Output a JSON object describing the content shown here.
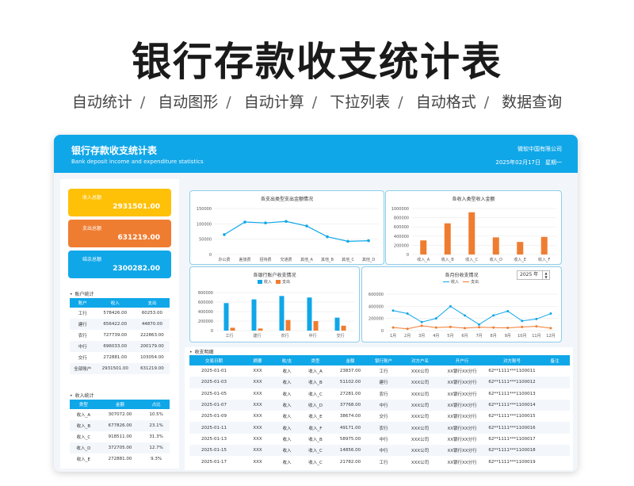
{
  "promo": {
    "title": "银行存款收支统计表",
    "features": [
      "自动统计",
      "自动图形",
      "自动计算",
      "下拉列表",
      "自动格式",
      "数据查询"
    ]
  },
  "header": {
    "title": "银行存款收支统计表",
    "subtitle": "Bank deposit income and expenditure statistics",
    "company": "微软中国有限公司",
    "date": "2025年02月17日",
    "weekday": "星期一"
  },
  "colors": {
    "blue": "#10a7e8",
    "yellow": "#ffc107",
    "orange": "#ef7d31",
    "cyan": "#10a7e8"
  },
  "cards": [
    {
      "label": "收入总额",
      "value": "2931501.00",
      "color": "#ffc107"
    },
    {
      "label": "支出总额",
      "value": "631219.00",
      "color": "#ef7d31"
    },
    {
      "label": "结余总额",
      "value": "2300282.00",
      "color": "#10a7e8"
    }
  ],
  "accounts": {
    "title": "账户统计",
    "headers": [
      "账户",
      "收入",
      "支出"
    ],
    "rows": [
      [
        "工行",
        "578426.00",
        "60253.00"
      ],
      [
        "建行",
        "656422.00",
        "44870.00"
      ],
      [
        "农行",
        "727739.00",
        "222863.00"
      ],
      [
        "中行",
        "696033.00",
        "200179.00"
      ],
      [
        "交行",
        "272881.00",
        "103054.00"
      ],
      [
        "全部账户",
        "2931501.00",
        "631219.00"
      ]
    ]
  },
  "income_stats": {
    "title": "收入统计",
    "headers": [
      "类型",
      "金额",
      "占比"
    ],
    "rows": [
      [
        "收入_A",
        "307072.00",
        "10.5%"
      ],
      [
        "收入_B",
        "677826.00",
        "23.1%"
      ],
      [
        "收入_C",
        "918511.00",
        "31.3%"
      ],
      [
        "收入_D",
        "372705.00",
        "12.7%"
      ],
      [
        "收入_E",
        "272881.00",
        "9.3%"
      ]
    ]
  },
  "year_select": {
    "value": "2025 年"
  },
  "chart_data": [
    {
      "type": "line",
      "title": "各支出类型支出金额情况",
      "categories": [
        "办公费",
        "差旅费",
        "招待费",
        "交通费",
        "其他_A",
        "其他_B",
        "其他_C",
        "其他_D"
      ],
      "values": [
        65000,
        106000,
        103000,
        108000,
        93000,
        58000,
        43000,
        45000
      ],
      "ylim": [
        0,
        150000
      ],
      "yticks": [
        "150000",
        "100000",
        "50000",
        "0"
      ]
    },
    {
      "type": "bar",
      "title": "各收入类型收入金额",
      "categories": [
        "收入_A",
        "收入_B",
        "收入_C",
        "收入_D",
        "收入_E",
        "收入_F"
      ],
      "values": [
        307072,
        677826,
        918511,
        372705,
        272881,
        383000
      ],
      "ylim": [
        0,
        1000000
      ],
      "yticks": [
        "1000000",
        "800000",
        "600000",
        "400000",
        "200000",
        "0"
      ]
    },
    {
      "type": "bar",
      "title": "各银行账户收支情况",
      "categories": [
        "工行",
        "建行",
        "农行",
        "中行",
        "交行"
      ],
      "series": [
        {
          "name": "收入",
          "values": [
            578426,
            656422,
            727739,
            696033,
            272881
          ]
        },
        {
          "name": "支出",
          "values": [
            60253,
            44870,
            222863,
            200179,
            103054
          ]
        }
      ],
      "ylim": [
        0,
        800000
      ],
      "yticks": [
        "800000",
        "600000",
        "400000",
        "200000",
        "0"
      ]
    },
    {
      "type": "line",
      "title": "各月份收支情况",
      "categories": [
        "1月",
        "2月",
        "3月",
        "4月",
        "5月",
        "6月",
        "7月",
        "8月",
        "9月",
        "10月",
        "11月",
        "12月"
      ],
      "series": [
        {
          "name": "收入",
          "values": [
            330000,
            280000,
            140000,
            200000,
            400000,
            250000,
            100000,
            250000,
            320000,
            160000,
            190000,
            280000
          ]
        },
        {
          "name": "支出",
          "values": [
            50000,
            30000,
            80000,
            50000,
            60000,
            40000,
            55000,
            50000,
            45000,
            60000,
            70000,
            40000
          ]
        }
      ],
      "ylim": [
        0,
        600000
      ],
      "yticks": [
        "600000",
        "400000",
        "200000",
        "0"
      ]
    }
  ],
  "details": {
    "title": "收支明细",
    "headers": [
      "交易日期",
      "摘要",
      "收/支",
      "类型",
      "金额",
      "银行账户",
      "对方户名",
      "开户行",
      "对方账号",
      "备注"
    ],
    "rows": [
      [
        "2025-01-01",
        "XXX",
        "收入",
        "收入_A",
        "23837.00",
        "工行",
        "XXX公司",
        "XX银行XX分行",
        "62**1111***1100011",
        ""
      ],
      [
        "2025-01-03",
        "XXX",
        "收入",
        "收入_B",
        "51102.00",
        "建行",
        "XXX公司",
        "XX银行XX分行",
        "62**1111***1100012",
        ""
      ],
      [
        "2025-01-05",
        "XXX",
        "收入",
        "收入_C",
        "27281.00",
        "农行",
        "XXX公司",
        "XX银行XX分行",
        "62**1111***1100013",
        ""
      ],
      [
        "2025-01-07",
        "XXX",
        "收入",
        "收入_D",
        "37768.00",
        "中行",
        "XXX公司",
        "XX银行XX分行",
        "62**1111***1100014",
        ""
      ],
      [
        "2025-01-09",
        "XXX",
        "收入",
        "收入_E",
        "38674.00",
        "交行",
        "XXX公司",
        "XX银行XX分行",
        "62**1111***1100015",
        ""
      ],
      [
        "2025-01-11",
        "XXX",
        "收入",
        "收入_F",
        "49171.00",
        "农行",
        "XXX公司",
        "XX银行XX分行",
        "62**1111***1100016",
        ""
      ],
      [
        "2025-01-13",
        "XXX",
        "收入",
        "收入_B",
        "58975.00",
        "中行",
        "XXX公司",
        "XX银行XX分行",
        "62**1111***1100017",
        ""
      ],
      [
        "2025-01-15",
        "XXX",
        "收入",
        "收入_C",
        "14856.00",
        "中行",
        "XXX公司",
        "XX银行XX分行",
        "62**1111***1100018",
        ""
      ],
      [
        "2025-01-17",
        "XXX",
        "收入",
        "收入_C",
        "21782.00",
        "工行",
        "XXX公司",
        "XX银行XX分行",
        "62**1111***1100019",
        ""
      ]
    ]
  }
}
